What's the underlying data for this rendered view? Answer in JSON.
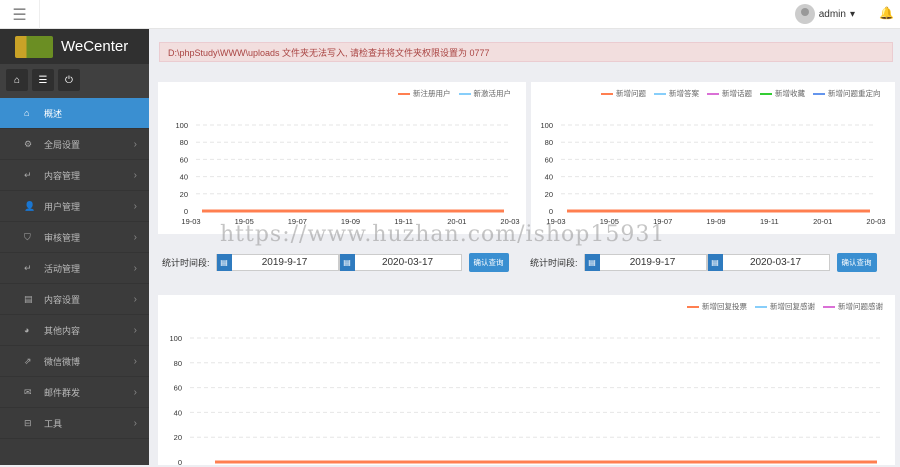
{
  "header": {
    "user": "admin",
    "caret": "▾"
  },
  "sidebar": {
    "brand": "WeCenter",
    "items": [
      {
        "label": "概述",
        "icon": "home-icon",
        "glyph": "⌂"
      },
      {
        "label": "全局设置",
        "icon": "gear-icon",
        "glyph": "⚙"
      },
      {
        "label": "内容管理",
        "icon": "reply-icon",
        "glyph": "↵"
      },
      {
        "label": "用户管理",
        "icon": "user-icon",
        "glyph": "👤"
      },
      {
        "label": "审核管理",
        "icon": "shield-icon",
        "glyph": "⛉"
      },
      {
        "label": "活动管理",
        "icon": "reply-icon",
        "glyph": "↵"
      },
      {
        "label": "内容设置",
        "icon": "list-icon",
        "glyph": "▤"
      },
      {
        "label": "其他内容",
        "icon": "pie-icon",
        "glyph": "◕"
      },
      {
        "label": "微信微博",
        "icon": "share-icon",
        "glyph": "⇗"
      },
      {
        "label": "邮件群发",
        "icon": "mail-icon",
        "glyph": "✉"
      },
      {
        "label": "工具",
        "icon": "briefcase-icon",
        "glyph": "⊟"
      }
    ]
  },
  "alert": "D:\\phpStudy\\WWW\\uploads 文件夹无法写入, 请检查并将文件夹权限设置为 0777",
  "filters": [
    {
      "label": "统计时间段:",
      "start": "2019-9-17",
      "end": "2020-03-17",
      "button": "确认查询"
    },
    {
      "label": "统计时间段:",
      "start": "2019-9-17",
      "end": "2020-03-17",
      "button": "确认查询"
    }
  ],
  "watermark": "https://www.huzhan.com/ishop15931",
  "chart_data": [
    {
      "type": "line",
      "x": [
        "19-03",
        "19-05",
        "19-07",
        "19-09",
        "19-11",
        "20-01",
        "20-03"
      ],
      "ylim": [
        0,
        100
      ],
      "yticks": [
        0,
        20,
        40,
        60,
        80,
        100
      ],
      "grid": true,
      "legend": "top",
      "series": [
        {
          "name": "新注册用户",
          "color": "#ff7f50",
          "values": [
            0,
            0,
            0,
            0,
            0,
            0,
            0
          ]
        },
        {
          "name": "新激活用户",
          "color": "#87cefa",
          "values": [
            0,
            0,
            0,
            0,
            0,
            0,
            0
          ]
        }
      ]
    },
    {
      "type": "line",
      "x": [
        "19-03",
        "19-05",
        "19-07",
        "19-09",
        "19-11",
        "20-01",
        "20-03"
      ],
      "ylim": [
        0,
        100
      ],
      "yticks": [
        0,
        20,
        40,
        60,
        80,
        100
      ],
      "grid": true,
      "legend": "top",
      "series": [
        {
          "name": "新增问题",
          "color": "#ff7f50",
          "values": [
            0,
            0,
            0,
            0,
            0,
            0,
            0
          ]
        },
        {
          "name": "新增答案",
          "color": "#87cefa",
          "values": [
            0,
            0,
            0,
            0,
            0,
            0,
            0
          ]
        },
        {
          "name": "新增话题",
          "color": "#da70d6",
          "values": [
            0,
            0,
            0,
            0,
            0,
            0,
            0
          ]
        },
        {
          "name": "新增收藏",
          "color": "#32cd32",
          "values": [
            0,
            0,
            0,
            0,
            0,
            0,
            0
          ]
        },
        {
          "name": "新增问题重定向",
          "color": "#6495ed",
          "values": [
            0,
            0,
            0,
            0,
            0,
            0,
            0
          ]
        }
      ]
    },
    {
      "type": "line",
      "x": [],
      "ylim": [
        0,
        100
      ],
      "yticks": [
        0,
        20,
        40,
        60,
        80,
        100
      ],
      "grid": true,
      "legend": "top-right",
      "series": [
        {
          "name": "新增回复投票",
          "color": "#ff7f50",
          "values": [
            0
          ]
        },
        {
          "name": "新增回复感谢",
          "color": "#87cefa",
          "values": [
            0
          ]
        },
        {
          "name": "新增问题感谢",
          "color": "#da70d6",
          "values": [
            0
          ]
        }
      ]
    }
  ]
}
